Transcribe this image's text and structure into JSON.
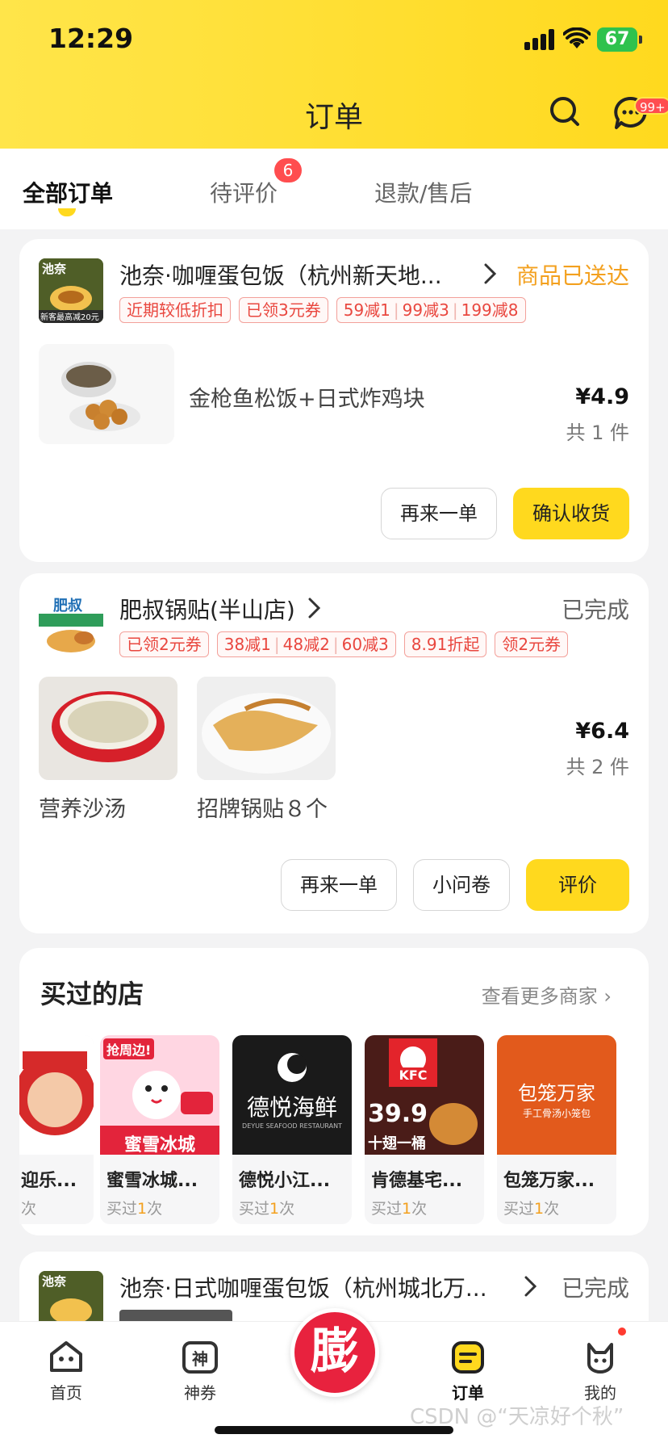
{
  "status_bar": {
    "time": "12:29",
    "battery": "67"
  },
  "header": {
    "title": "订单",
    "message_badge": "99+"
  },
  "tabs": [
    {
      "label": "全部订单",
      "active": true
    },
    {
      "label": "待评价",
      "badge": "6"
    },
    {
      "label": "退款/售后"
    }
  ],
  "orders": [
    {
      "store_name": "池奈·咖喱蛋包饭（杭州新天地...",
      "status": "商品已送达",
      "logo_text": "池奈",
      "logo_subtext": "新客最高减20元",
      "promos": [
        "近期较低折扣",
        "已领3元券",
        "59减1",
        "99减3",
        "199减8"
      ],
      "goods_name": "金枪鱼松饭+日式炸鸡块",
      "price": "¥4.9",
      "qty": "共 1 件",
      "buttons": {
        "reorder": "再来一单",
        "confirm": "确认收货"
      }
    },
    {
      "store_name": "肥叔锅贴(半山店)",
      "status": "已完成",
      "logo_text": "肥叔",
      "promos": [
        "已领2元券",
        "38减1",
        "48减2",
        "60减3",
        "8.91折起",
        "领2元券"
      ],
      "goods": [
        {
          "name": "营养沙汤"
        },
        {
          "name": "招牌锅贴８个"
        }
      ],
      "price": "¥6.4",
      "qty": "共 2 件",
      "buttons": {
        "reorder": "再来一单",
        "survey": "小问卷",
        "review": "评价"
      }
    },
    {
      "store_name": "池奈·日式咖喱蛋包饭（杭州城北万...",
      "status": "已完成",
      "logo_text": "池奈"
    }
  ],
  "shops": {
    "title": "买过的店",
    "more": "查看更多商家",
    "items": [
      {
        "name": "迎乐...",
        "bought_prefix": "",
        "count": "",
        "bought_suffix": "次"
      },
      {
        "name": "蜜雪冰城...",
        "bought_prefix": "买过",
        "count": "1",
        "bought_suffix": "次",
        "img_text": "蜜雪冰城",
        "img_banner": "抢周边!"
      },
      {
        "name": "德悦小江...",
        "bought_prefix": "买过",
        "count": "1",
        "bought_suffix": "次",
        "img_text": "德悦海鲜",
        "img_sub": "DEYUE SEAFOOD RESTAURANT"
      },
      {
        "name": "肯德基宅...",
        "bought_prefix": "买过",
        "count": "1",
        "bought_suffix": "次",
        "img_text": "KFC",
        "img_price": "39.9",
        "img_sub": "十翅一桶"
      },
      {
        "name": "包笼万家...",
        "bought_prefix": "买过",
        "count": "1",
        "bought_suffix": "次",
        "img_text": "包笼万家",
        "img_sub": "手工骨汤小笼包"
      }
    ]
  },
  "bottom_nav": [
    {
      "label": "首页"
    },
    {
      "label": "神券",
      "icon_text": "神"
    },
    {
      "label": "订单",
      "active": true
    },
    {
      "label": "我的"
    }
  ],
  "center_button": "膨",
  "watermark": "CSDN @“天凉好个秋”",
  "colors": {
    "brand_yellow": "#ffd91e",
    "promo_red": "#e9473f",
    "status_orange": "#f3a01e"
  }
}
